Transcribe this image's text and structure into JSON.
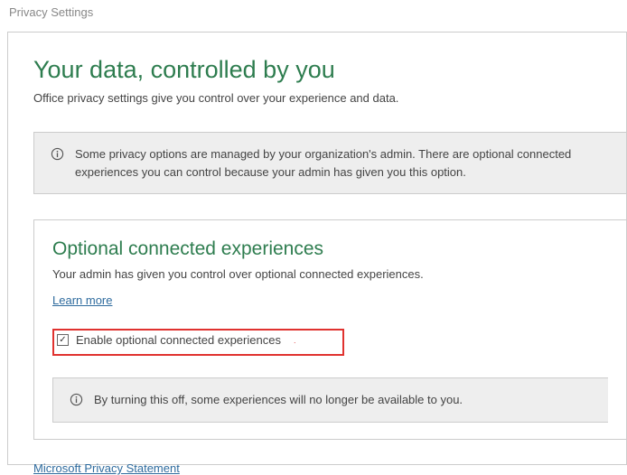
{
  "window": {
    "title": "Privacy Settings"
  },
  "main": {
    "heading": "Your data, controlled by you",
    "subheading": "Office privacy settings give you control over your experience and data."
  },
  "admin_notice": {
    "text": "Some privacy options are managed by your organization's admin. There are optional connected experiences you can control because your admin has given you this option."
  },
  "section": {
    "title": "Optional connected experiences",
    "desc": "Your admin has given you control over optional connected experiences.",
    "learn_more": "Learn more",
    "checkbox_label": "Enable optional connected experiences",
    "checkbox_checked": true,
    "off_notice": "By turning this off, some experiences will no longer be available to you."
  },
  "footer": {
    "privacy_link": "Microsoft Privacy Statement"
  }
}
